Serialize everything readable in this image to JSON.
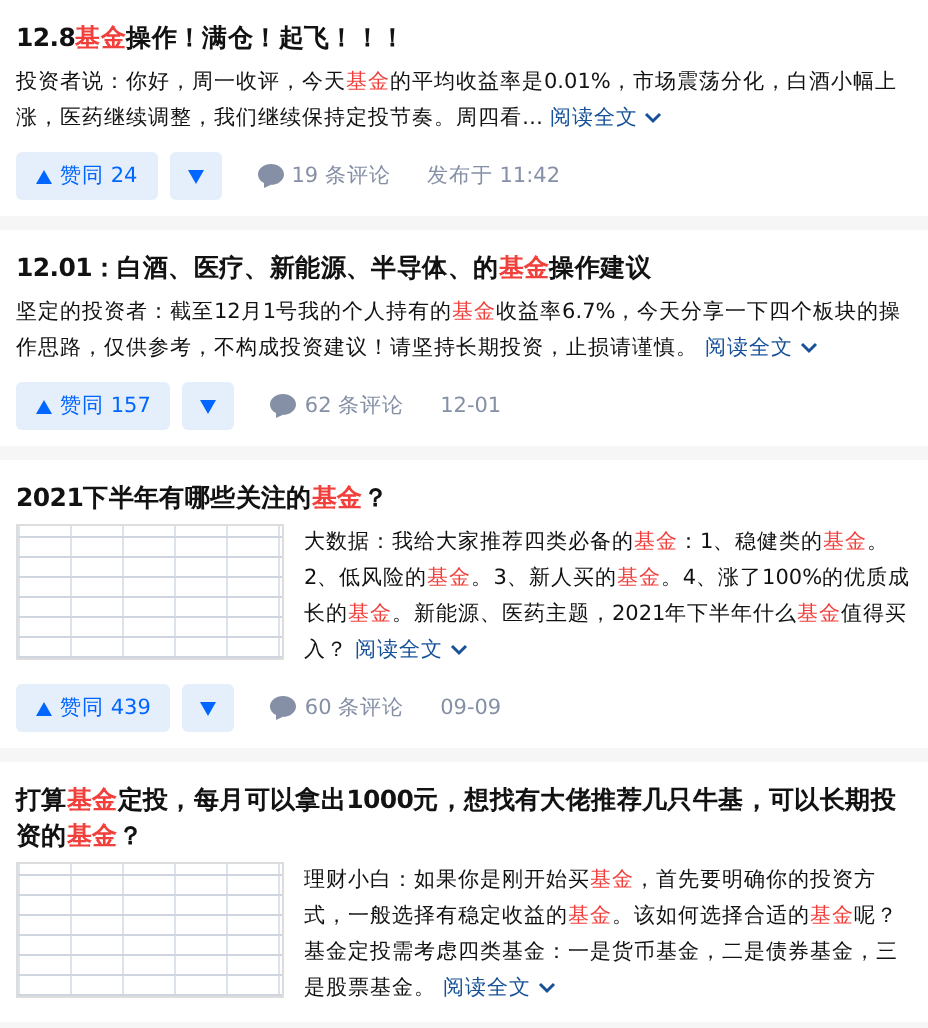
{
  "items": [
    {
      "title": "12.8**基金**操作！满仓！起飞！！！",
      "excerpt": "投资者说：你好，周一收评，今天**基金**的平均收益率是0.01%，市场震荡分化，白酒小幅上涨，医药继续调整，我们继续保持定投节奏。周四看…",
      "thumbnail": false,
      "read_more": "阅读全文",
      "vote": "赞同 24",
      "comments": "19 条评论",
      "time": "发布于 11:42"
    },
    {
      "title": "12.01：白酒、医疗、新能源、半导体、的**基金**操作建议",
      "excerpt": "坚定的投资者：截至12月1号我的个人持有的**基金**收益率6.7%，今天分享一下四个板块的操作思路，仅供参考，不构成投资建议！请坚持长期投资，止损请谨慎。",
      "thumbnail": false,
      "read_more": "阅读全文",
      "vote": "赞同 157",
      "comments": "62 条评论",
      "time": "12-01"
    },
    {
      "title": "2021下半年有哪些关注的**基金**？",
      "excerpt": "大数据：我给大家推荐四类必备的**基金**：1、稳健类的**基金**。2、低风险的**基金**。3、新人买的**基金**。4、涨了100%的优质成长的**基金**。新能源、医药主题，2021年下半年什么**基金**值得买入？",
      "thumbnail": true,
      "read_more": "阅读全文",
      "vote": "赞同 439",
      "comments": "60 条评论",
      "time": "09-09"
    },
    {
      "title": "打算**基金**定投，每月可以拿出1000元，想找有大佬推荐几只牛基，可以长期投资的**基金**？",
      "excerpt": "理财小白：如果你是刚开始买**基金**，首先要明确你的投资方式，一般选择有稳定收益的**基金**。该如何选择合适的**基金**呢？基金定投需考虑四类基金：一是货币基金，二是债券基金，三是股票基金。",
      "thumbnail": true,
      "read_more": "阅读全文"
    }
  ]
}
